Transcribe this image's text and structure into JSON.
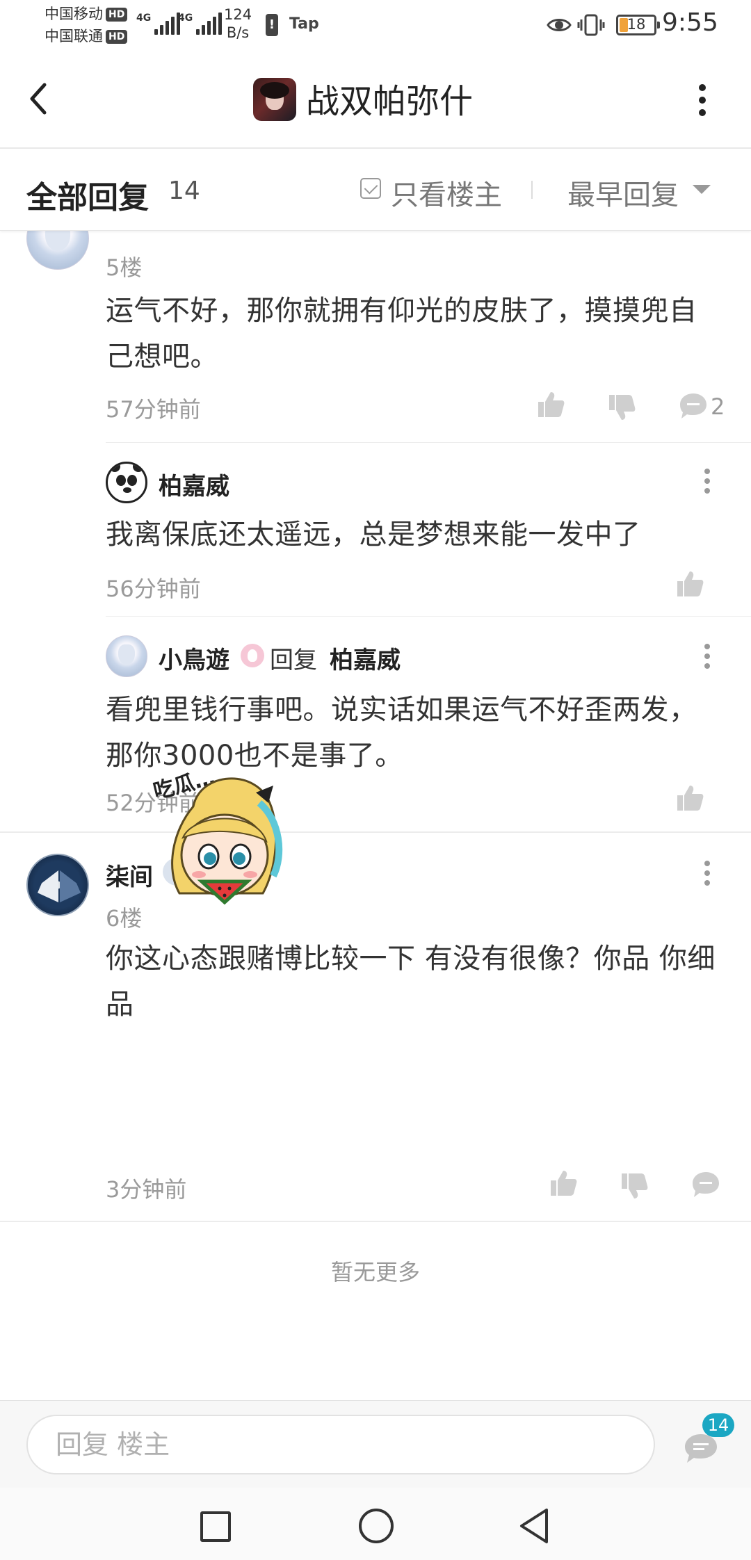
{
  "status_bar": {
    "carrier1": "中国移动",
    "carrier2": "中国联通",
    "hd": "HD",
    "net1": "4G",
    "net2": "4G",
    "speed_value": "124",
    "speed_unit": "B/s",
    "battery_warn": "!",
    "tap_label": "Tap",
    "battery": "18",
    "time": "9:55"
  },
  "nav": {
    "title": "战双帕弥什"
  },
  "header": {
    "title": "全部回复",
    "count": "14",
    "only_op": "只看楼主",
    "sort": "最早回复"
  },
  "posts": [
    {
      "floor": "5楼",
      "text": "运气不好，那你就拥有仰光的皮肤了，摸摸兜自己想吧。",
      "time": "57分钟前",
      "comment_count": "2",
      "replies": [
        {
          "author": "柏嘉威",
          "text": "我离保底还太遥远，总是梦想来能一发中了",
          "time": "56分钟前"
        },
        {
          "author": "小鳥遊",
          "reply_word": "回复",
          "reply_to": "柏嘉威",
          "text": "看兜里钱行事吧。说实话如果运气不好歪两发，那你3000也不是事了。",
          "time": "52分钟前"
        }
      ]
    },
    {
      "author": "柒间",
      "badge": "T",
      "floor": "6楼",
      "text": "你这心态跟赌博比较一下 有没有很像？你品 你细品",
      "sticker_text": "吃瓜…",
      "time": "3分钟前"
    }
  ],
  "footer": {
    "no_more": "暂无更多"
  },
  "reply_bar": {
    "placeholder": "回复  楼主",
    "comment_badge": "14"
  },
  "colors": {
    "accent": "#1ba7c3",
    "text": "#222222",
    "muted": "#999999"
  }
}
